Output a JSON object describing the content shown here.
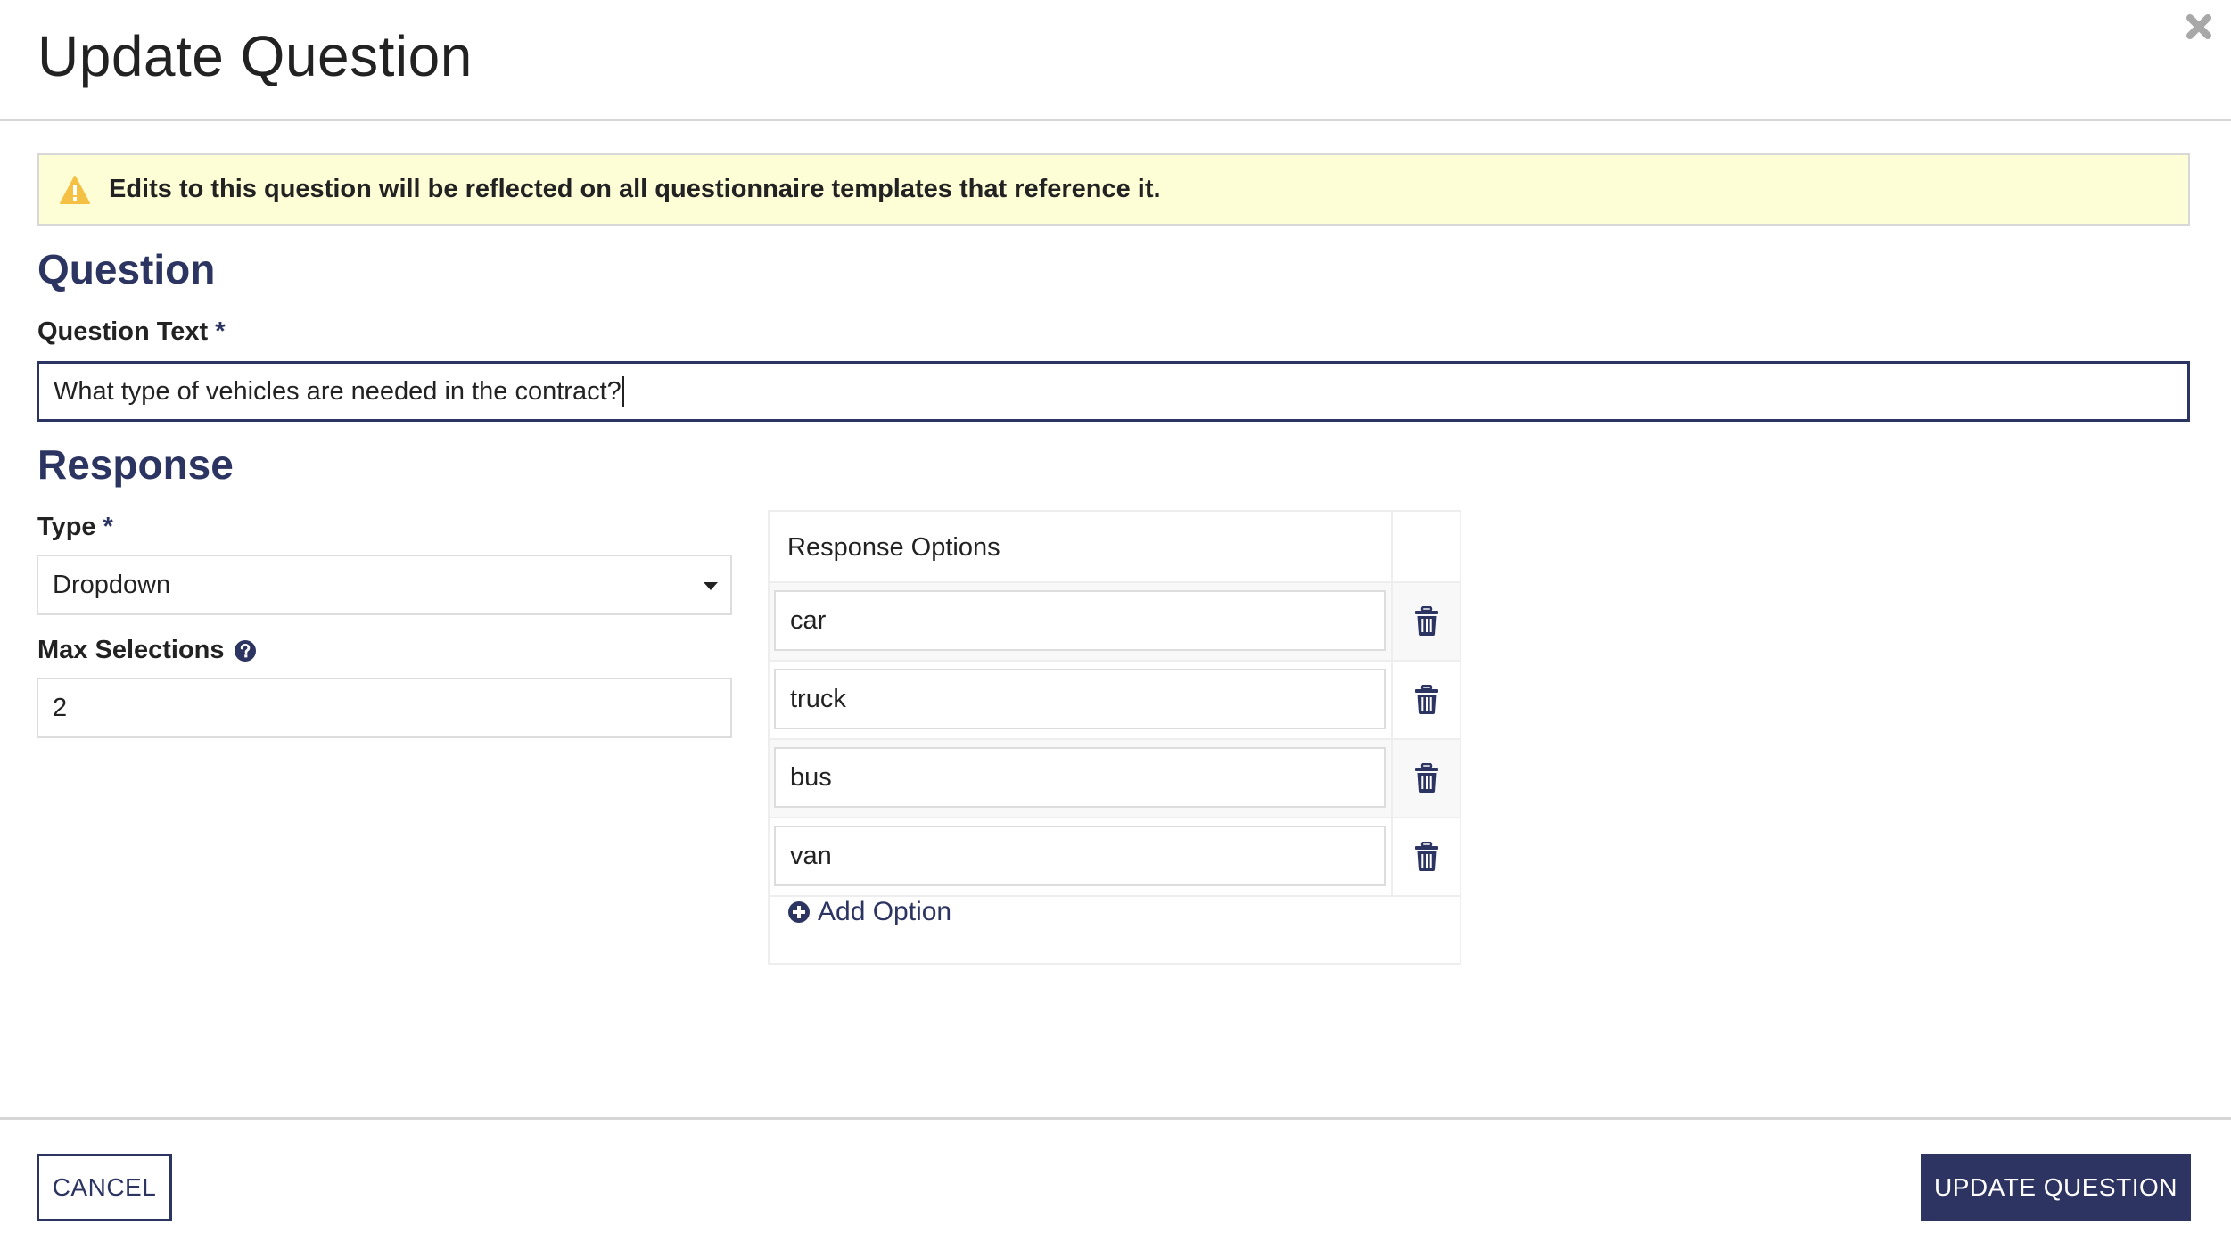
{
  "header": {
    "title": "Update Question",
    "close_icon": "close-icon"
  },
  "alert": {
    "icon": "warning-triangle-icon",
    "text": "Edits to this question will be reflected on all questionnaire templates that reference it.",
    "background_color": "#fdfdd6",
    "icon_color": "#f5c144"
  },
  "question_section": {
    "heading": "Question",
    "question_text_label": "Question Text",
    "required_marker": "*",
    "question_text_value": "What type of vehicles are needed in the contract?"
  },
  "response_section": {
    "heading": "Response",
    "type_label": "Type",
    "required_marker": "*",
    "type_value": "Dropdown",
    "max_selections_label": "Max Selections",
    "max_selections_help_icon": "question-circle-icon",
    "max_selections_value": "2"
  },
  "response_options": {
    "header": "Response Options",
    "options": [
      {
        "value": "car"
      },
      {
        "value": "truck"
      },
      {
        "value": "bus"
      },
      {
        "value": "van"
      }
    ],
    "delete_icon": "trash-icon",
    "add_option_label": "Add Option",
    "add_option_icon": "plus-circle-icon"
  },
  "footer": {
    "cancel_label": "CANCEL",
    "update_label": "UPDATE QUESTION"
  },
  "colors": {
    "primary": "#2e3462",
    "heading": "#2c3461",
    "text": "#222222",
    "border": "#dddddd",
    "close_icon": "#a8a8a8"
  }
}
